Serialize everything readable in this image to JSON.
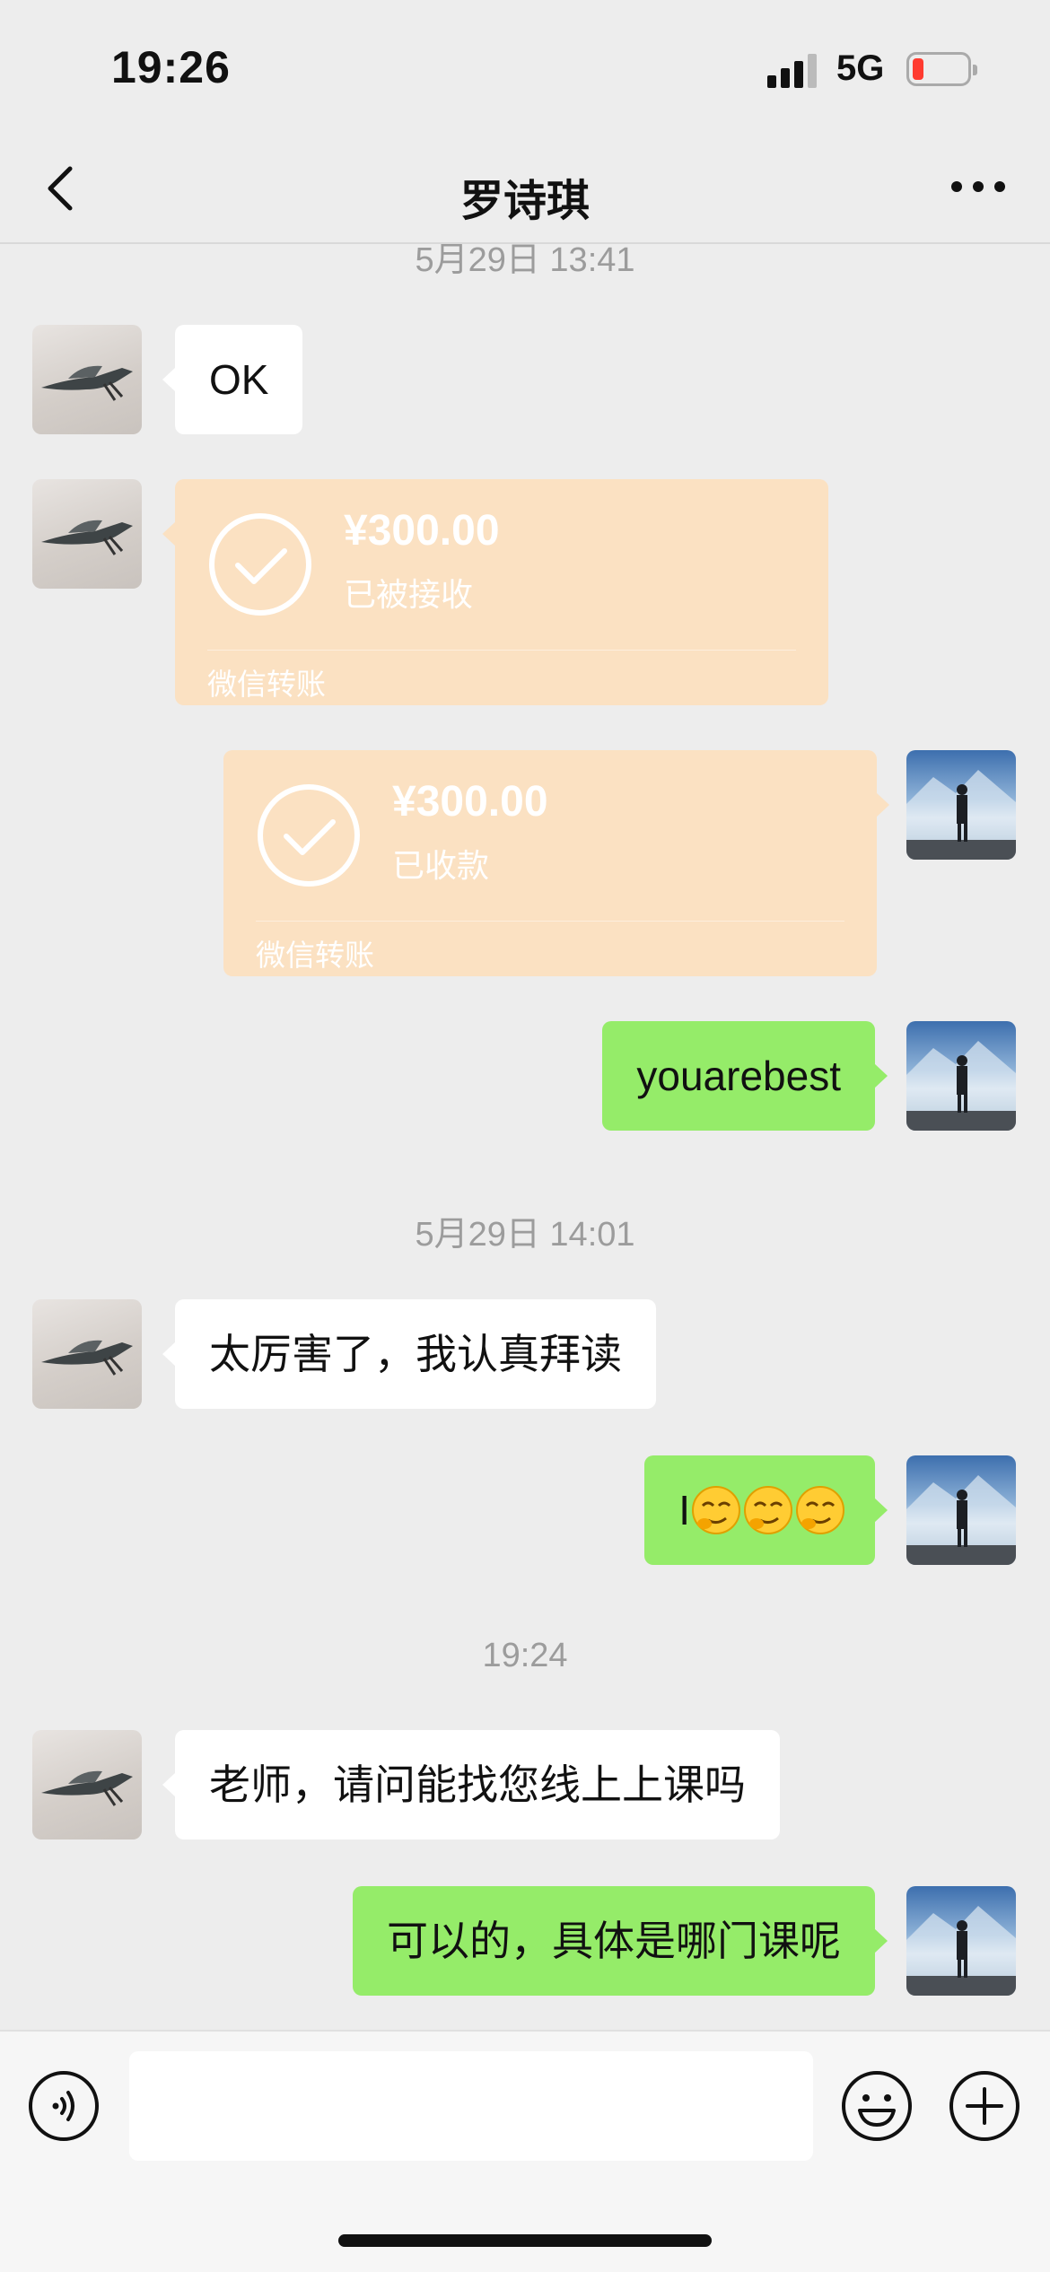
{
  "status_bar": {
    "time": "19:26",
    "network": "5G",
    "battery_level": 0.15,
    "battery_color": "#ff3b30"
  },
  "nav": {
    "title": "罗诗琪",
    "back_icon": "chevron-left-icon",
    "more_icon": "more-horizontal-icon"
  },
  "messages": {
    "ts_top": "5月29日 13:41",
    "m1_text": "OK",
    "transfer_in": {
      "amount": "¥300.00",
      "status": "已被接收",
      "label": "微信转账"
    },
    "transfer_out": {
      "amount": "¥300.00",
      "status": "已收款",
      "label": "微信转账"
    },
    "m4_text": "youarebest",
    "ts_2": "5月29日 14:01",
    "m5_text": "太厉害了，我认真拜读",
    "m6_prefix": "I",
    "m6_emoji": [
      "smirk-face-icon",
      "smirk-face-icon",
      "smirk-face-icon"
    ],
    "ts_3": "19:24",
    "m7_text": "老师，请问能找您线上上课吗",
    "m8_text": "可以的，具体是哪门课呢"
  },
  "input_bar": {
    "voice_icon": "voice-icon",
    "emoji_icon": "emoji-icon",
    "plus_icon": "plus-icon",
    "value": ""
  },
  "colors": {
    "bubble_self": "#95ec69",
    "bubble_other": "#ffffff",
    "transfer_card": "#fbe1c2",
    "background": "#ededed"
  }
}
